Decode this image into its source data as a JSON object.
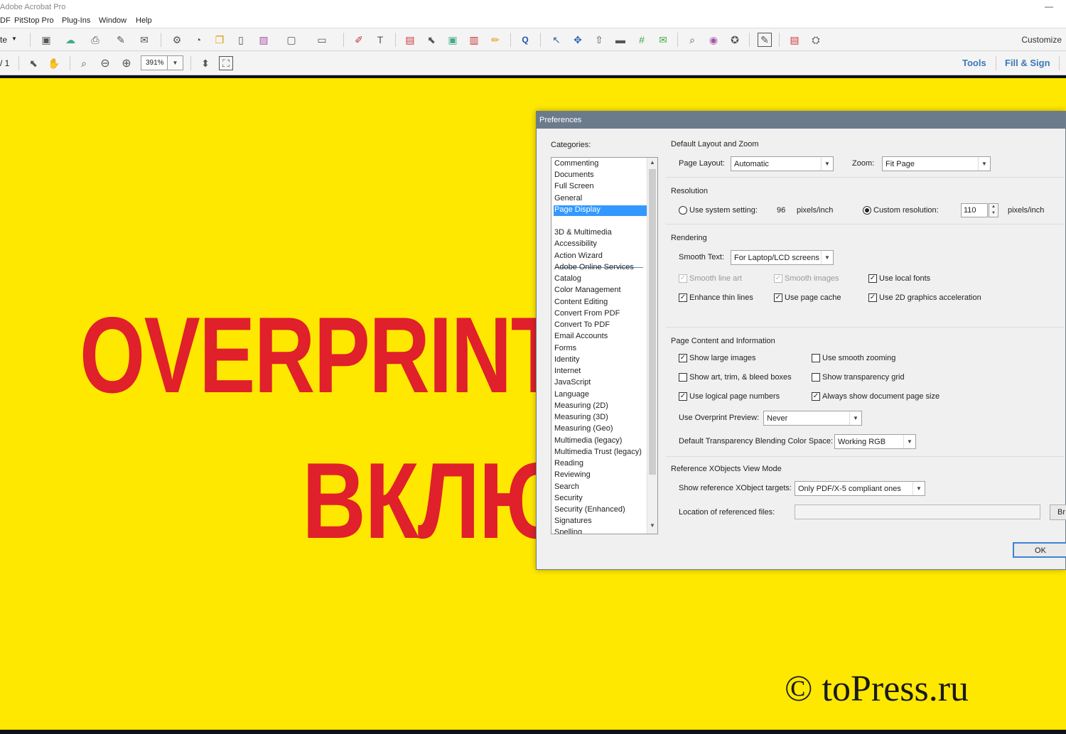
{
  "app": {
    "title": "Adobe Acrobat Pro"
  },
  "menu": [
    "DF",
    "PitStop Pro",
    "Plug-Ins",
    "Window",
    "Help"
  ],
  "toolbar": {
    "left_label": "te",
    "page_counter": "/ 1",
    "zoom_value": "391%",
    "customize_label": "Customize",
    "tools_label": "Tools",
    "fill_sign_label": "Fill & Sign"
  },
  "document": {
    "line1": "OVERPRINT",
    "line2": "ВКЛЮЧ",
    "watermark": "© toPress.ru",
    "background_color": "#ffe800",
    "text_color": "#e0202a"
  },
  "dialog": {
    "title": "Preferences",
    "categories_label": "Categories:",
    "categories_top": [
      "Commenting",
      "Documents",
      "Full Screen",
      "General",
      "Page Display"
    ],
    "categories_bottom": [
      "3D & Multimedia",
      "Accessibility",
      "Action Wizard",
      "Adobe Online Services",
      "Catalog",
      "Color Management",
      "Content Editing",
      "Convert From PDF",
      "Convert To PDF",
      "Email Accounts",
      "Forms",
      "Identity",
      "Internet",
      "JavaScript",
      "Language",
      "Measuring (2D)",
      "Measuring (3D)",
      "Measuring (Geo)",
      "Multimedia (legacy)",
      "Multimedia Trust (legacy)",
      "Reading",
      "Reviewing",
      "Search",
      "Security",
      "Security (Enhanced)",
      "Signatures",
      "Spelling"
    ],
    "selected_category": "Page Display",
    "layout_zoom": {
      "heading": "Default Layout and Zoom",
      "page_layout_label": "Page Layout:",
      "page_layout_value": "Automatic",
      "zoom_label": "Zoom:",
      "zoom_value": "Fit Page"
    },
    "resolution": {
      "heading": "Resolution",
      "system_label": "Use system setting:",
      "system_value": "96",
      "system_unit": "pixels/inch",
      "custom_label": "Custom resolution:",
      "custom_value": "110",
      "custom_unit": "pixels/inch"
    },
    "rendering": {
      "heading": "Rendering",
      "smooth_text_label": "Smooth Text:",
      "smooth_text_value": "For Laptop/LCD screens",
      "smooth_line_art": "Smooth line art",
      "smooth_images": "Smooth images",
      "use_local_fonts": "Use local fonts",
      "enhance_thin_lines": "Enhance thin lines",
      "use_page_cache": "Use page cache",
      "use_2d_accel": "Use 2D graphics acceleration"
    },
    "page_content": {
      "heading": "Page Content and Information",
      "show_large_images": "Show large images",
      "use_smooth_zooming": "Use smooth zooming",
      "show_art_trim": "Show art, trim, & bleed boxes",
      "show_transparency_grid": "Show transparency grid",
      "use_logical_page_numbers": "Use logical page numbers",
      "always_show_page_size": "Always show document page size",
      "overprint_label": "Use Overprint Preview:",
      "overprint_value": "Never",
      "blending_label": "Default Transparency Blending Color Space:",
      "blending_value": "Working RGB"
    },
    "xobjects": {
      "heading": "Reference XObjects View Mode",
      "targets_label": "Show reference XObject targets:",
      "targets_value": "Only PDF/X-5 compliant ones",
      "location_label": "Location of referenced files:",
      "browse_label": "Br"
    },
    "ok_label": "OK"
  }
}
